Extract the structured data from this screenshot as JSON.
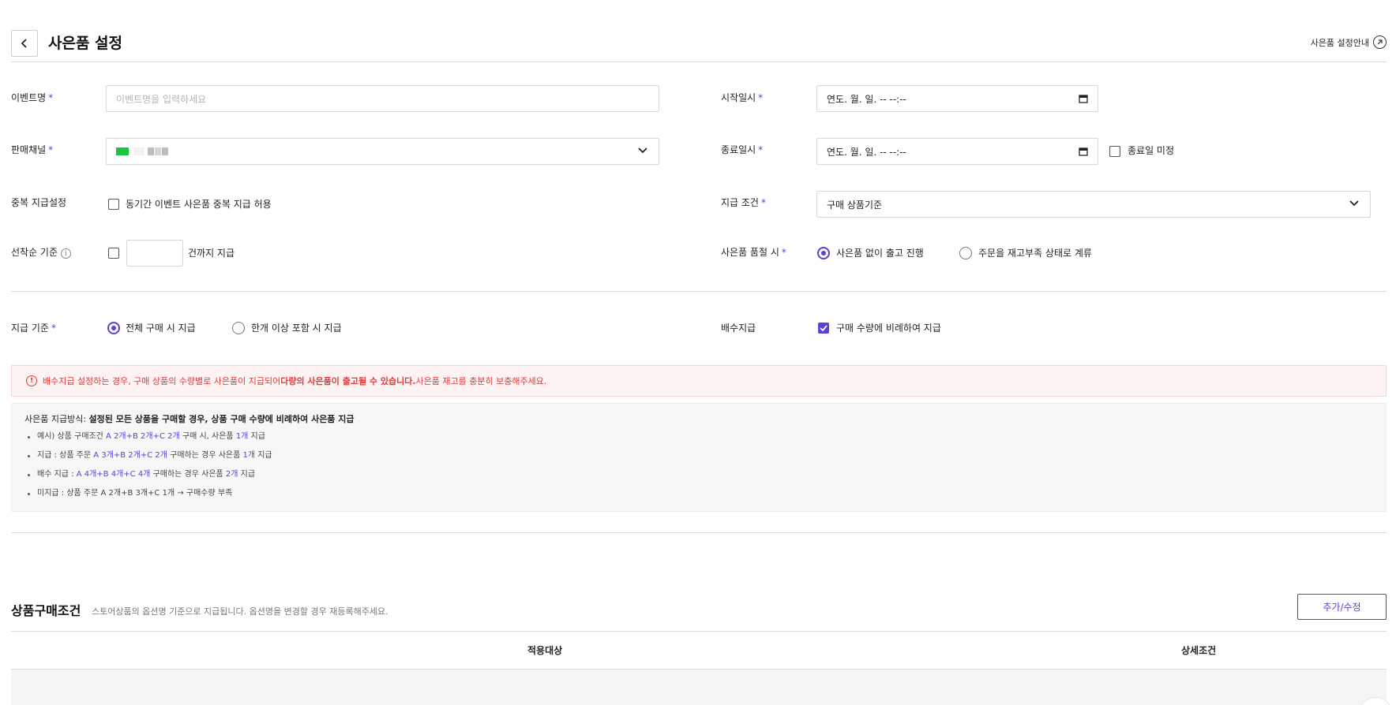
{
  "header": {
    "title": "사은품 설정",
    "guide_link": "사은품 설정안내"
  },
  "form": {
    "event_name": {
      "label": "이벤트명",
      "placeholder": "이벤트명을 입력하세요",
      "value": ""
    },
    "sales_channel": {
      "label": "판매채널"
    },
    "duplicate": {
      "label": "중복 지급설정",
      "option": "동기간 이벤트 사은품 중복 지급 허용",
      "checked": false
    },
    "first_come": {
      "label": "선착순 기준",
      "suffix": "건까지 지급",
      "checked": false,
      "value": ""
    },
    "start_date": {
      "label": "시작일시",
      "value": "연도. 월. 일. -- --:--"
    },
    "end_date": {
      "label": "종료일시",
      "value": "연도. 월. 일. -- --:--",
      "undecided_label": "종료일 미정",
      "undecided_checked": false
    },
    "pay_condition": {
      "label": "지급 조건",
      "selected": "구매 상품기준"
    },
    "soldout": {
      "label": "사은품 품절 시",
      "options": [
        "사은품 없이 출고 진행",
        "주문을 재고부족 상태로 계류"
      ],
      "selected_index": 0
    },
    "pay_basis": {
      "label": "지급 기준",
      "options": [
        "전체 구매 시 지급",
        "한개 이상 포함 시 지급"
      ],
      "selected_index": 0
    },
    "multiple": {
      "label": "배수지급",
      "option": "구매 수량에 비례하여 지급",
      "checked": true
    }
  },
  "alert": {
    "icon": "exclamation-circle-icon",
    "text_before": "배수지급 설정하는 경우, 구매 상품의 수량별로 사은품이 지급되어 ",
    "text_bold": "다량의 사은품이 출고될 수 있습니다.",
    "text_after": " 사은품 재고를 충분히 보충해주세요."
  },
  "info": {
    "title_prefix": "사은품 지급방식: ",
    "title_bold": "설정된 모든 상품을 구매할 경우, 상품 구매 수량에 비례하여 사은품 지급",
    "items": [
      {
        "a": "예시) 상품 구매조건 ",
        "b": "A 2개+B 2개+C 2개",
        "c": " 구매 시, 사은품 ",
        "d": "1개",
        "e": " 지급"
      },
      {
        "a": "지급 : 상품 주문 ",
        "b": "A 3개+B 2개+C 2개",
        "c": " 구매하는 경우 사은품 ",
        "d": "1개",
        "e": " 지급"
      },
      {
        "a": "배수 지급 : ",
        "b": "A 4개+B 4개+C 4개",
        "c": " 구매하는 경우 사은품 ",
        "d": "2개",
        "e": " 지급"
      }
    ],
    "last_item": "미지급 : 상품 주문 A 2개+B 3개+C 1개 → 구매수량 부족"
  },
  "purchase_section": {
    "title": "상품구매조건",
    "description": "스토어상품의 옵션명 기준으로 지급됩니다. 옵션명을 변경할 경우 재등록해주세요.",
    "edit_button": "추가/수정",
    "columns": [
      "적용대상",
      "상세조건"
    ]
  },
  "colors": {
    "accent": "#5b3fd6",
    "danger": "#e03a3a",
    "border": "#d8d8d8"
  }
}
